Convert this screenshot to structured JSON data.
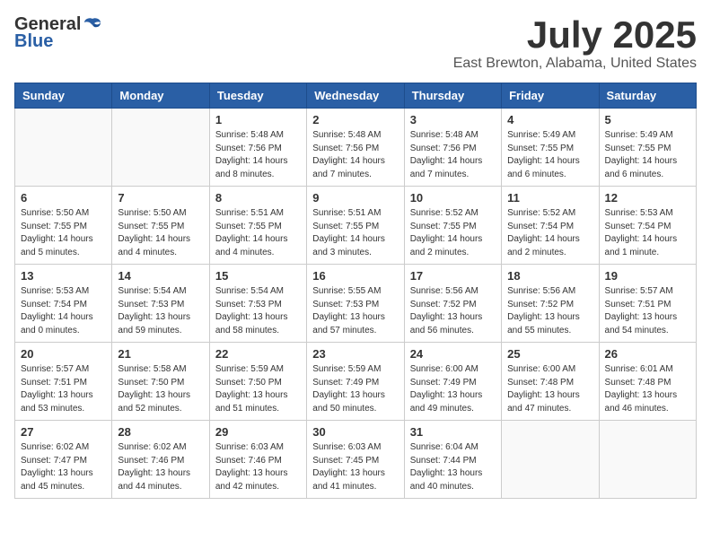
{
  "header": {
    "logo_general": "General",
    "logo_blue": "Blue",
    "title": "July 2025",
    "location": "East Brewton, Alabama, United States"
  },
  "weekdays": [
    "Sunday",
    "Monday",
    "Tuesday",
    "Wednesday",
    "Thursday",
    "Friday",
    "Saturday"
  ],
  "weeks": [
    [
      {
        "day": "",
        "info": ""
      },
      {
        "day": "",
        "info": ""
      },
      {
        "day": "1",
        "info": "Sunrise: 5:48 AM\nSunset: 7:56 PM\nDaylight: 14 hours\nand 8 minutes."
      },
      {
        "day": "2",
        "info": "Sunrise: 5:48 AM\nSunset: 7:56 PM\nDaylight: 14 hours\nand 7 minutes."
      },
      {
        "day": "3",
        "info": "Sunrise: 5:48 AM\nSunset: 7:56 PM\nDaylight: 14 hours\nand 7 minutes."
      },
      {
        "day": "4",
        "info": "Sunrise: 5:49 AM\nSunset: 7:55 PM\nDaylight: 14 hours\nand 6 minutes."
      },
      {
        "day": "5",
        "info": "Sunrise: 5:49 AM\nSunset: 7:55 PM\nDaylight: 14 hours\nand 6 minutes."
      }
    ],
    [
      {
        "day": "6",
        "info": "Sunrise: 5:50 AM\nSunset: 7:55 PM\nDaylight: 14 hours\nand 5 minutes."
      },
      {
        "day": "7",
        "info": "Sunrise: 5:50 AM\nSunset: 7:55 PM\nDaylight: 14 hours\nand 4 minutes."
      },
      {
        "day": "8",
        "info": "Sunrise: 5:51 AM\nSunset: 7:55 PM\nDaylight: 14 hours\nand 4 minutes."
      },
      {
        "day": "9",
        "info": "Sunrise: 5:51 AM\nSunset: 7:55 PM\nDaylight: 14 hours\nand 3 minutes."
      },
      {
        "day": "10",
        "info": "Sunrise: 5:52 AM\nSunset: 7:55 PM\nDaylight: 14 hours\nand 2 minutes."
      },
      {
        "day": "11",
        "info": "Sunrise: 5:52 AM\nSunset: 7:54 PM\nDaylight: 14 hours\nand 2 minutes."
      },
      {
        "day": "12",
        "info": "Sunrise: 5:53 AM\nSunset: 7:54 PM\nDaylight: 14 hours\nand 1 minute."
      }
    ],
    [
      {
        "day": "13",
        "info": "Sunrise: 5:53 AM\nSunset: 7:54 PM\nDaylight: 14 hours\nand 0 minutes."
      },
      {
        "day": "14",
        "info": "Sunrise: 5:54 AM\nSunset: 7:53 PM\nDaylight: 13 hours\nand 59 minutes."
      },
      {
        "day": "15",
        "info": "Sunrise: 5:54 AM\nSunset: 7:53 PM\nDaylight: 13 hours\nand 58 minutes."
      },
      {
        "day": "16",
        "info": "Sunrise: 5:55 AM\nSunset: 7:53 PM\nDaylight: 13 hours\nand 57 minutes."
      },
      {
        "day": "17",
        "info": "Sunrise: 5:56 AM\nSunset: 7:52 PM\nDaylight: 13 hours\nand 56 minutes."
      },
      {
        "day": "18",
        "info": "Sunrise: 5:56 AM\nSunset: 7:52 PM\nDaylight: 13 hours\nand 55 minutes."
      },
      {
        "day": "19",
        "info": "Sunrise: 5:57 AM\nSunset: 7:51 PM\nDaylight: 13 hours\nand 54 minutes."
      }
    ],
    [
      {
        "day": "20",
        "info": "Sunrise: 5:57 AM\nSunset: 7:51 PM\nDaylight: 13 hours\nand 53 minutes."
      },
      {
        "day": "21",
        "info": "Sunrise: 5:58 AM\nSunset: 7:50 PM\nDaylight: 13 hours\nand 52 minutes."
      },
      {
        "day": "22",
        "info": "Sunrise: 5:59 AM\nSunset: 7:50 PM\nDaylight: 13 hours\nand 51 minutes."
      },
      {
        "day": "23",
        "info": "Sunrise: 5:59 AM\nSunset: 7:49 PM\nDaylight: 13 hours\nand 50 minutes."
      },
      {
        "day": "24",
        "info": "Sunrise: 6:00 AM\nSunset: 7:49 PM\nDaylight: 13 hours\nand 49 minutes."
      },
      {
        "day": "25",
        "info": "Sunrise: 6:00 AM\nSunset: 7:48 PM\nDaylight: 13 hours\nand 47 minutes."
      },
      {
        "day": "26",
        "info": "Sunrise: 6:01 AM\nSunset: 7:48 PM\nDaylight: 13 hours\nand 46 minutes."
      }
    ],
    [
      {
        "day": "27",
        "info": "Sunrise: 6:02 AM\nSunset: 7:47 PM\nDaylight: 13 hours\nand 45 minutes."
      },
      {
        "day": "28",
        "info": "Sunrise: 6:02 AM\nSunset: 7:46 PM\nDaylight: 13 hours\nand 44 minutes."
      },
      {
        "day": "29",
        "info": "Sunrise: 6:03 AM\nSunset: 7:46 PM\nDaylight: 13 hours\nand 42 minutes."
      },
      {
        "day": "30",
        "info": "Sunrise: 6:03 AM\nSunset: 7:45 PM\nDaylight: 13 hours\nand 41 minutes."
      },
      {
        "day": "31",
        "info": "Sunrise: 6:04 AM\nSunset: 7:44 PM\nDaylight: 13 hours\nand 40 minutes."
      },
      {
        "day": "",
        "info": ""
      },
      {
        "day": "",
        "info": ""
      }
    ]
  ]
}
